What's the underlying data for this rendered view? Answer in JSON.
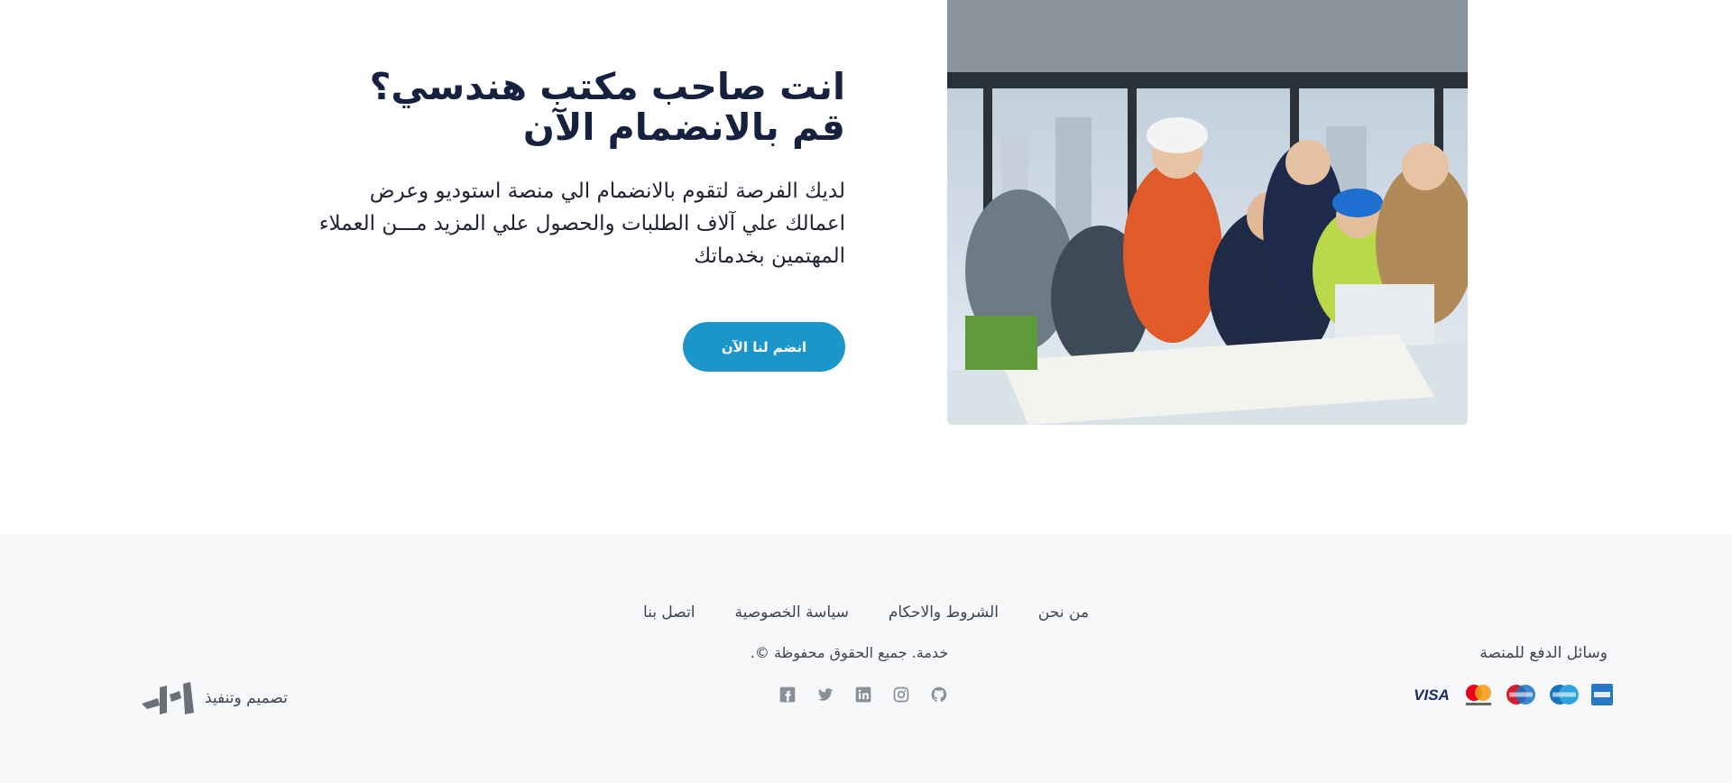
{
  "hero": {
    "title_line1": "انت صاحب مكتب هندسي؟",
    "title_line2": "قم بالانضمام الآن",
    "description": "لديك الفرصة لتقوم بالانضمام الي منصة استوديو وعرض اعمالك علي آلاف الطلبات والحصول علي المزيد مـــن العملاء المهتمين بخدماتك",
    "join_label": "انضم لنا الآن",
    "image_icon": "engineering-team-photo"
  },
  "footer": {
    "links": [
      "من نحن",
      "الشروط والاحكام",
      "سياسة الخصوصية",
      "اتصل بنا"
    ],
    "copyright": "خدمة. جميع الحقوق محفوظة ©.",
    "social_icons": [
      "facebook-icon",
      "twitter-icon",
      "linkedin-icon",
      "instagram-icon",
      "github-icon"
    ],
    "payment_title": "وسائل الدفع للمنصة",
    "payment_methods": [
      "VISA",
      "Mastercard",
      "Maestro",
      "Cirrus",
      "American Express"
    ],
    "credit_text": "تصميم وتنفيذ",
    "credit_logo_icon": "erwad-logo-icon"
  },
  "colors": {
    "accent": "#1c95c8",
    "heading": "#16203f",
    "footer_bg": "#f7f8fa",
    "icon_gray": "#8a8f99"
  }
}
